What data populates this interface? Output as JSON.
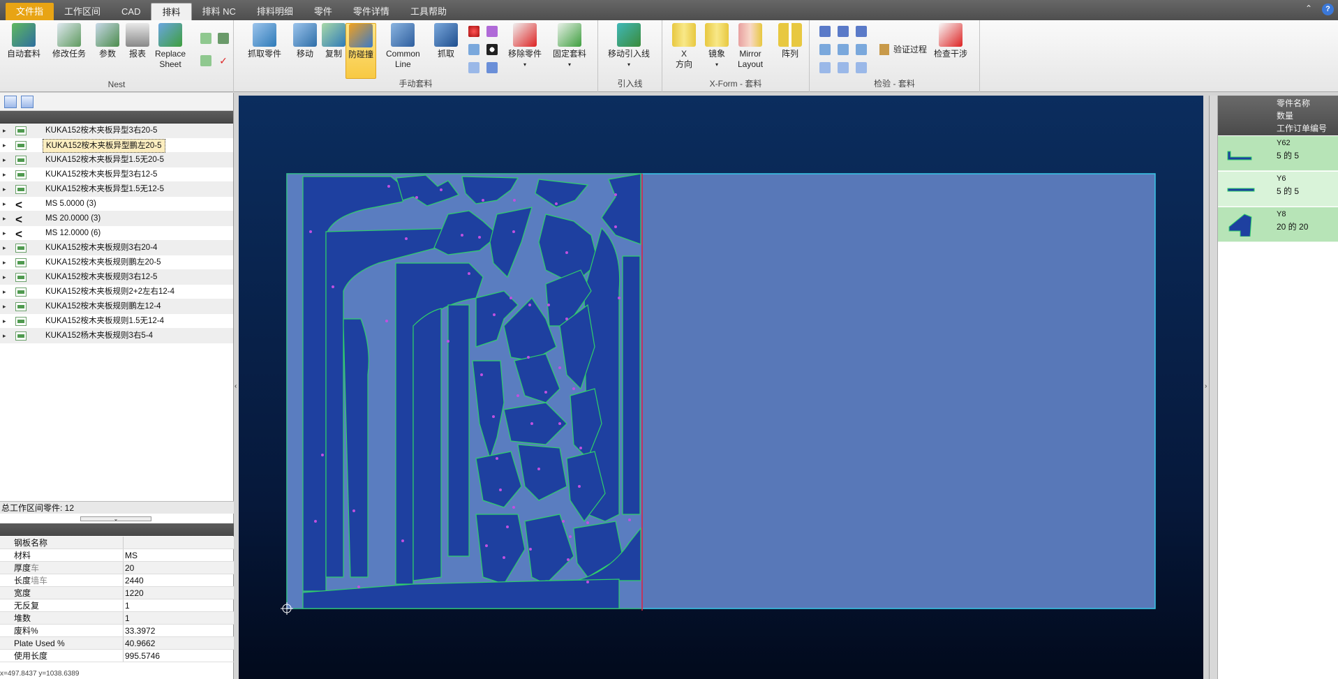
{
  "menubar": {
    "tabs": [
      "文件指",
      "工作区间",
      "CAD",
      "排料",
      "排料 NC",
      "排料明细",
      "零件",
      "零件详情",
      "工具帮助"
    ]
  },
  "ribbon": {
    "nest": {
      "label": "Nest",
      "auto": "自动套料",
      "modify": "修改任务",
      "params": "参数",
      "report": "报表",
      "replace": "Replace\nSheet"
    },
    "manual": {
      "label": "手动套料",
      "grab_part": "抓取零件",
      "move": "移动",
      "copy": "复制",
      "collision": "防碰撞",
      "common_line": "Common\nLine",
      "grab": "抓取",
      "remove_part": "移除零件",
      "fix_nest": "固定套料"
    },
    "leadin": {
      "label": "引入线",
      "move_leadin": "移动引入线"
    },
    "xform": {
      "label": "X-Form - 套料",
      "x_dir": "X\n方向",
      "mirror": "镜象",
      "mirror_layout": "Mirror\nLayout",
      "array": "阵列"
    },
    "verify": {
      "label": "检验 - 套料",
      "verify_process": "验证过程",
      "check_interference": "检查干涉"
    }
  },
  "tree": {
    "items": [
      {
        "label": "KUKA152桉木夹板异型3右20-5",
        "type": "part"
      },
      {
        "label": "KUKA152桉木夹板异型鹏左20-5",
        "type": "part",
        "selected": true
      },
      {
        "label": "KUKA152桉木夹板异型1.5无20-5",
        "type": "part"
      },
      {
        "label": "KUKA152桉木夹板异型3右12-5",
        "type": "part"
      },
      {
        "label": "KUKA152桉木夹板异型1.5无12-5",
        "type": "part"
      },
      {
        "label": "MS 5.0000 (3)",
        "type": "material"
      },
      {
        "label": "MS 20.0000 (3)",
        "type": "material"
      },
      {
        "label": "MS 12.0000 (6)",
        "type": "material"
      },
      {
        "label": "KUKA152桉木夹板规则3右20-4",
        "type": "part"
      },
      {
        "label": "KUKA152桉木夹板规则鹏左20-5",
        "type": "part"
      },
      {
        "label": "KUKA152桉木夹板规则3右12-5",
        "type": "part"
      },
      {
        "label": "KUKA152桉木夹板规则2+2左右12-4",
        "type": "part"
      },
      {
        "label": "KUKA152桉木夹板规则鹏左12-4",
        "type": "part"
      },
      {
        "label": "KUKA152桉木夹板规则1.5无12-4",
        "type": "part"
      },
      {
        "label": "KUKA152杨木夹板规则3右5-4",
        "type": "part"
      }
    ],
    "total": "总工作区间零件: 12"
  },
  "props": [
    {
      "k": "钢板名称",
      "v": ""
    },
    {
      "k": "材料",
      "v": "MS"
    },
    {
      "k": "厚度",
      "suffix": "车",
      "v": "20"
    },
    {
      "k": "长度",
      "suffix": "墙车",
      "v": "2440"
    },
    {
      "k": "宽度",
      "v": "1220"
    },
    {
      "k": "无反复",
      "v": "1"
    },
    {
      "k": "堆数",
      "v": "1"
    },
    {
      "k": "废料%",
      "v": "33.3972"
    },
    {
      "k": "Plate Used %",
      "v": "40.9662"
    },
    {
      "k": "使用长度",
      "v": "995.5746"
    }
  ],
  "coords": "x=497.8437 y=1038.6389",
  "right_panel": {
    "headers": [
      "零件名称",
      "数量",
      "工作订单编号"
    ],
    "rows": [
      {
        "name": "Y62",
        "count": "5 的 5"
      },
      {
        "name": "Y6",
        "count": "5 的 5"
      },
      {
        "name": "Y8",
        "count": "20 的 20"
      }
    ]
  },
  "colors": {
    "file_tab": "#e8a414",
    "plate": "#5878b8",
    "part_fill": "#1e40a0",
    "part_edge": "#2fcf6a",
    "canvas": "#0b2d5e",
    "row_green": "#b7e4b7"
  }
}
